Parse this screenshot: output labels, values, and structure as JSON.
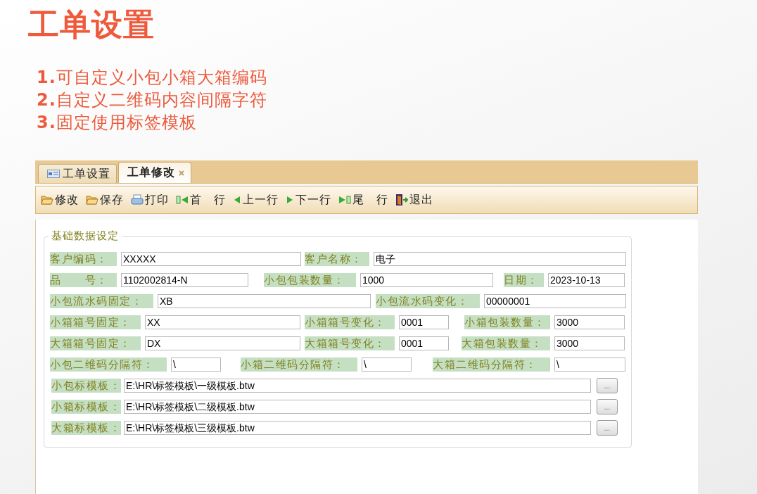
{
  "slide": {
    "title": "工单设置",
    "points": [
      "**1.**可自定义小包小箱大箱编码",
      "**2.**自定义二维码内容间隔字符",
      "**3.**固定使用标签模板"
    ]
  },
  "tabs": [
    {
      "label": "工单设置",
      "selected": false
    },
    {
      "label": "工单修改",
      "selected": true
    }
  ],
  "toolbar": [
    {
      "kind": "folder",
      "label": "修改"
    },
    {
      "kind": "folder",
      "label": "保存"
    },
    {
      "kind": "printer",
      "label": "打印"
    },
    {
      "kind": "first",
      "label": "首　行"
    },
    {
      "kind": "prev",
      "label": "上一行"
    },
    {
      "kind": "next",
      "label": "下一行"
    },
    {
      "kind": "last",
      "label": "尾　行"
    },
    {
      "kind": "exit",
      "label": "退出"
    }
  ],
  "form": {
    "legend": "基础数据设定",
    "rows": [
      {
        "kind": "fields",
        "fields": [
          {
            "label": "客户编码：",
            "value": "XXXXX"
          },
          {
            "label": "客户名称：",
            "value": "电子"
          }
        ]
      },
      {
        "kind": "fields",
        "fields": [
          {
            "label": "品　　号：",
            "value": "1102002814-N"
          },
          {
            "label": "小包包装数量：",
            "value": "1000"
          },
          {
            "label": "日期：",
            "value": "2023-10-13"
          }
        ]
      },
      {
        "kind": "fields",
        "fields": [
          {
            "label": "小包流水码固定：",
            "value": "XB"
          },
          {
            "label": "小包流水码变化：",
            "value": "00000001"
          }
        ]
      },
      {
        "kind": "fields",
        "fields": [
          {
            "label": "小箱箱号固定：",
            "value": "XX"
          },
          {
            "label": "小箱箱号变化：",
            "value": "0001"
          },
          {
            "label": "小箱包装数量：",
            "value": "3000"
          }
        ]
      },
      {
        "kind": "fields",
        "fields": [
          {
            "label": "大箱箱号固定：",
            "value": "DX"
          },
          {
            "label": "大箱箱号变化：",
            "value": "0001"
          },
          {
            "label": "大箱包装数量：",
            "value": "3000"
          }
        ]
      },
      {
        "kind": "fields",
        "fields": [
          {
            "label": "小包二维码分隔符：",
            "value": "\\"
          },
          {
            "label": "小箱二维码分隔符：",
            "value": "\\"
          },
          {
            "label": "大箱二维码分隔符：",
            "value": "\\"
          }
        ]
      },
      {
        "kind": "file",
        "label": "小包标模板：",
        "value": "E:\\HR\\标签模板\\一级模板.btw",
        "button": "..."
      },
      {
        "kind": "file",
        "label": "小箱标模板：",
        "value": "E:\\HR\\标签模板\\二级模板.btw",
        "button": "..."
      },
      {
        "kind": "file",
        "label": "大箱标模板：",
        "value": "E:\\HR\\标签模板\\三级模板.btw",
        "button": "..."
      }
    ]
  }
}
